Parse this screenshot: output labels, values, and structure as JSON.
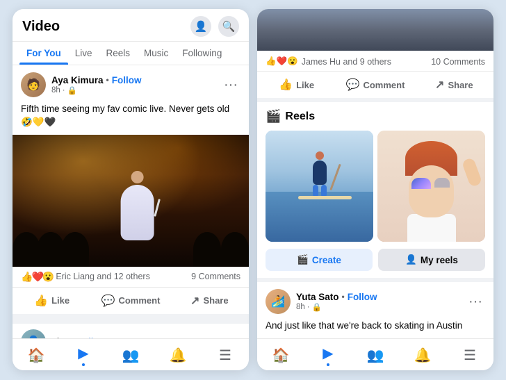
{
  "app": {
    "title": "Video",
    "background": "#d8e4f0"
  },
  "left_phone": {
    "header": {
      "title": "Video",
      "icons": [
        "person",
        "search"
      ]
    },
    "tabs": [
      {
        "label": "For You",
        "active": true
      },
      {
        "label": "Live",
        "active": false
      },
      {
        "label": "Reels",
        "active": false
      },
      {
        "label": "Music",
        "active": false
      },
      {
        "label": "Following",
        "active": false
      }
    ],
    "post": {
      "author": "Aya Kimura",
      "follow": "Follow",
      "time": "8h",
      "lock": "🔒",
      "text": "Fifth time seeing my fav comic live. Never gets old 🤣💛🖤",
      "reactions": [
        "👍",
        "❤️",
        "😮"
      ],
      "reactor": "Eric Liang and 12 others",
      "comments": "9 Comments",
      "actions": [
        "Like",
        "Comment",
        "Share"
      ]
    },
    "bottom_nav": {
      "items": [
        "🏠",
        "▶",
        "👥",
        "🔔",
        "☰"
      ]
    }
  },
  "right_phone": {
    "engagement": {
      "reactions": [
        "👍",
        "❤️",
        "😮"
      ],
      "reactor_text": "James Hu and 9 others",
      "comments": "10 Comments"
    },
    "actions": [
      "Like",
      "Comment",
      "Share"
    ],
    "reels_section": {
      "title": "Reels",
      "buttons": [
        {
          "label": "Create",
          "type": "primary"
        },
        {
          "label": "My reels",
          "type": "secondary"
        }
      ]
    },
    "post2": {
      "author": "Yuta Sato",
      "follow": "Follow",
      "time": "8h",
      "text": "And just like that we're back to skating in Austin"
    },
    "bottom_nav": {
      "items": [
        "🏠",
        "▶",
        "👥",
        "🔔",
        "☰"
      ]
    }
  }
}
